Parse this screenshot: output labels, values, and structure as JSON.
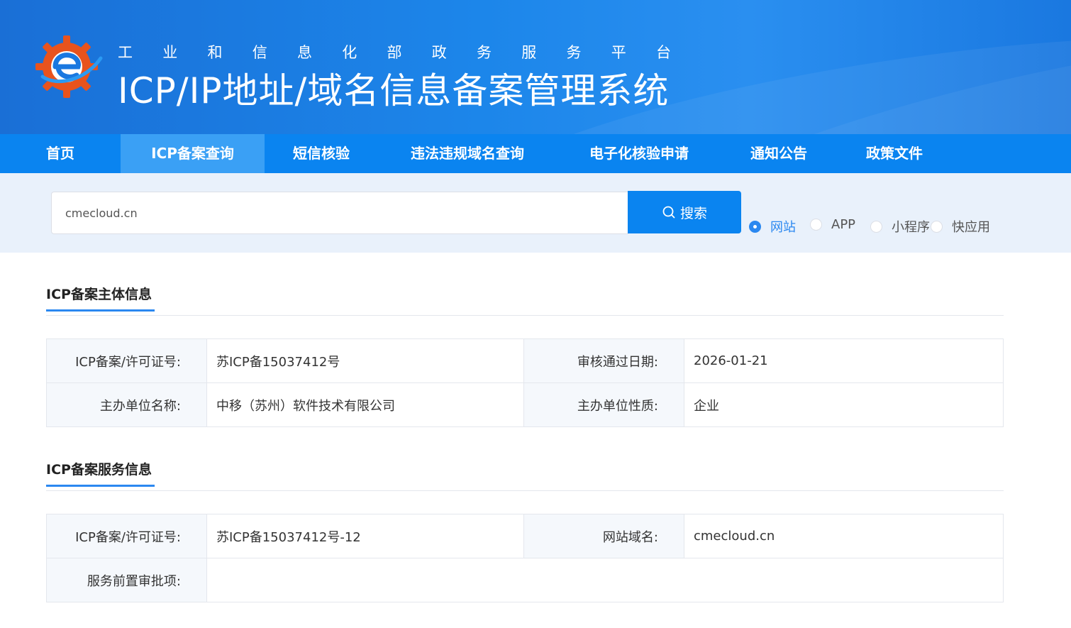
{
  "header": {
    "subtitle_chars": [
      "工",
      "业",
      "和",
      "信",
      "息",
      "化",
      "部",
      "政",
      "务",
      "服",
      "务",
      "平",
      "台"
    ],
    "title": "ICP/IP地址/域名信息备案管理系统",
    "logo_icon": "gear-e-logo-icon"
  },
  "nav": {
    "items": [
      {
        "label": "首页",
        "active": false
      },
      {
        "label": "ICP备案查询",
        "active": true
      },
      {
        "label": "短信核验",
        "active": false
      },
      {
        "label": "违法违规域名查询",
        "active": false
      },
      {
        "label": "电子化核验申请",
        "active": false
      },
      {
        "label": "通知公告",
        "active": false
      },
      {
        "label": "政策文件",
        "active": false
      }
    ]
  },
  "search": {
    "value": "cmecloud.cn",
    "button_label": "搜索",
    "button_icon": "search-icon",
    "types": [
      {
        "label": "网站",
        "checked": true
      },
      {
        "label": "APP",
        "checked": false
      },
      {
        "label": "小程序",
        "checked": false
      },
      {
        "label": "快应用",
        "checked": false
      }
    ]
  },
  "subject_info": {
    "title": "ICP备案主体信息",
    "rows": [
      {
        "k1": "ICP备案/许可证号:",
        "v1": "苏ICP备15037412号",
        "k2": "审核通过日期:",
        "v2": "2026-01-21"
      },
      {
        "k1": "主办单位名称:",
        "v1": "中移（苏州）软件技术有限公司",
        "k2": "主办单位性质:",
        "v2": "企业"
      }
    ]
  },
  "service_info": {
    "title": "ICP备案服务信息",
    "rows": [
      {
        "k1": "ICP备案/许可证号:",
        "v1": "苏ICP备15037412号-12",
        "k2": "网站域名:",
        "v2": "cmecloud.cn"
      }
    ],
    "approval_label": "服务前置审批项:",
    "approval_value": ""
  },
  "colors": {
    "nav_bg": "#0a84f0",
    "nav_active": "#3aa0f5",
    "accent": "#2b88f0",
    "search_band": "#e9f1fb"
  }
}
